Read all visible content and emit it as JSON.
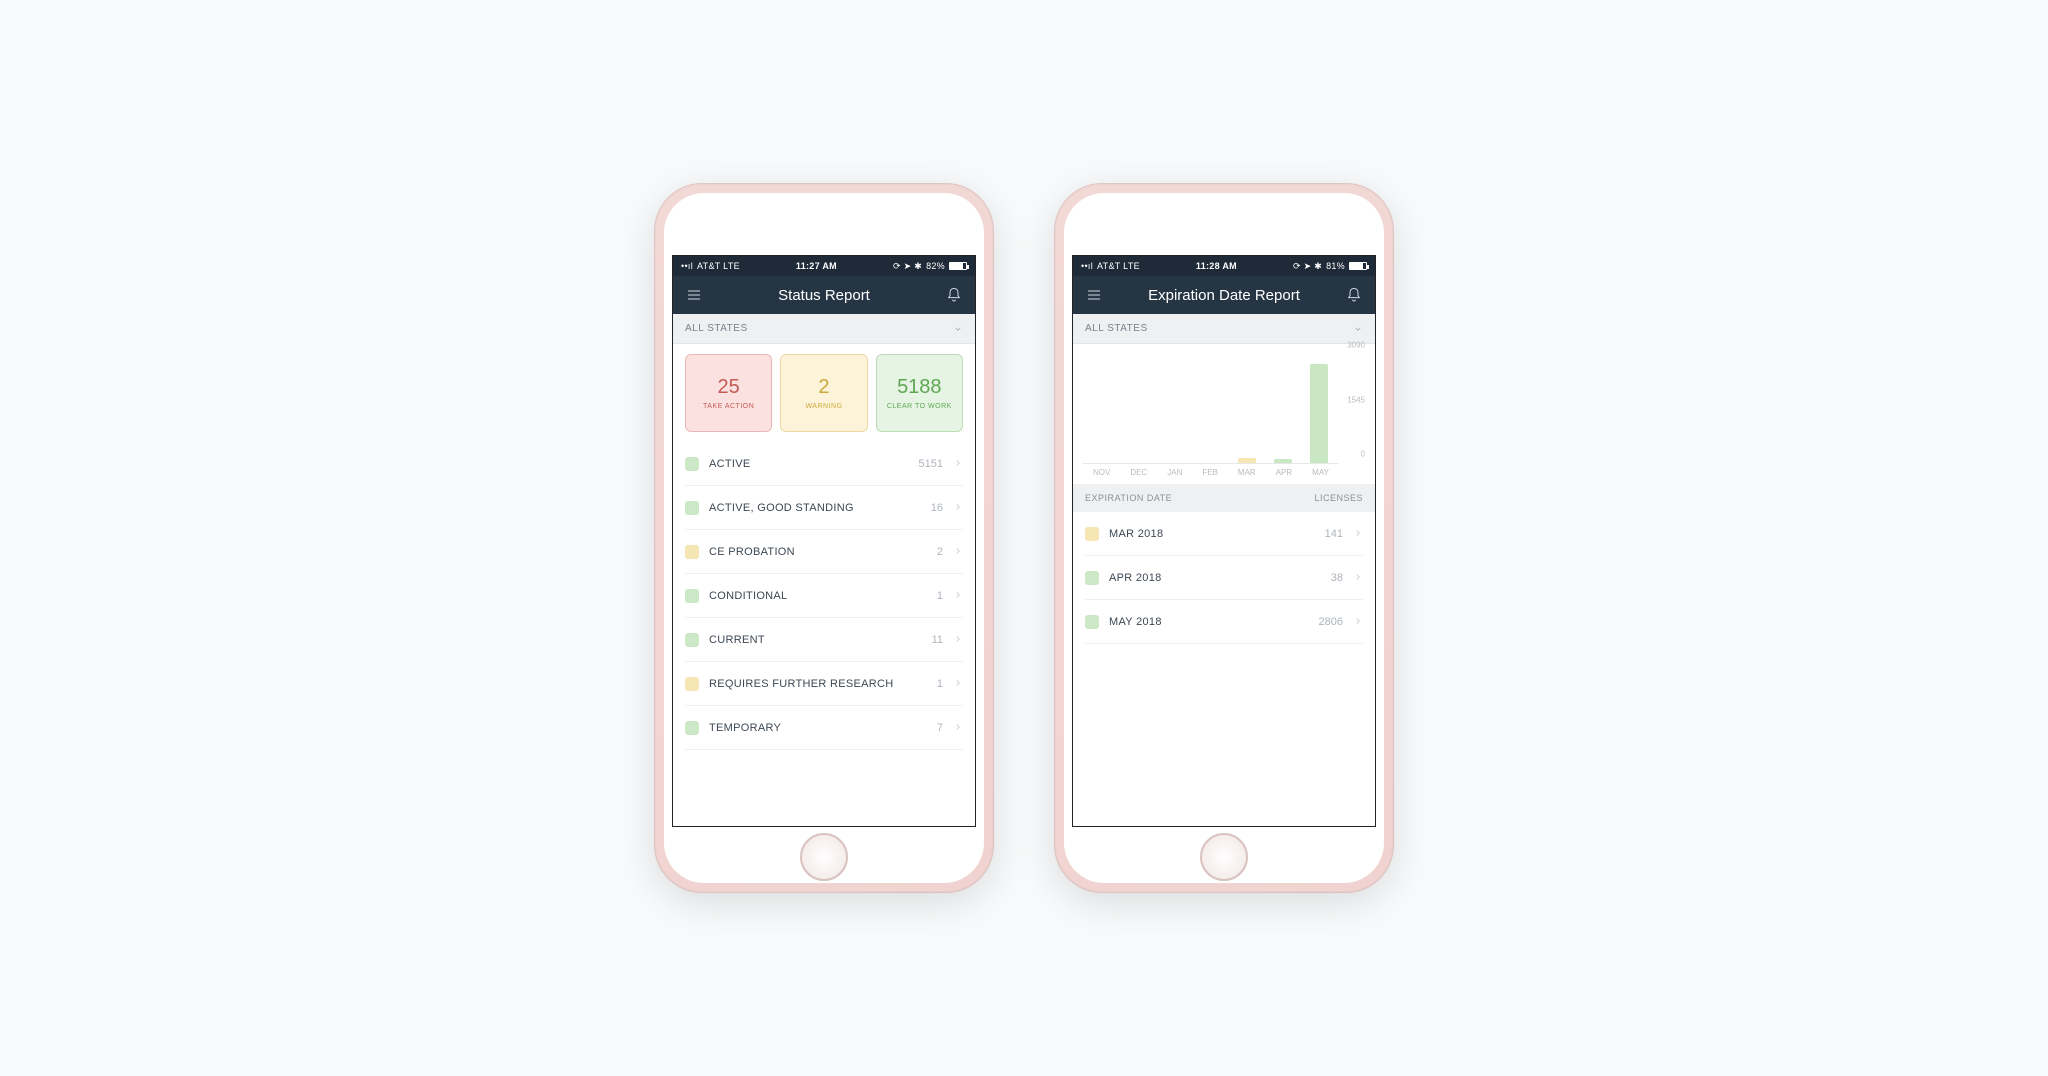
{
  "colors": {
    "green_swatch": "#cde8c6",
    "yellow_swatch": "#f5e6b3",
    "green_bar": "#c9e7c2",
    "yellow_bar": "#f5e6b3"
  },
  "phone_left": {
    "statusbar": {
      "carrier": "AT&T  LTE",
      "time": "11:27 AM",
      "battery_pct": "82%"
    },
    "header": {
      "title": "Status Report"
    },
    "filter": {
      "label": "ALL STATES"
    },
    "cards": [
      {
        "value": "25",
        "label": "TAKE ACTION",
        "variant": "red"
      },
      {
        "value": "2",
        "label": "WARNING",
        "variant": "yellow"
      },
      {
        "value": "5188",
        "label": "CLEAR TO WORK",
        "variant": "green"
      }
    ],
    "list": [
      {
        "swatch": "green",
        "label": "ACTIVE",
        "value": "5151"
      },
      {
        "swatch": "green",
        "label": "ACTIVE, GOOD STANDING",
        "value": "16"
      },
      {
        "swatch": "yellow",
        "label": "CE PROBATION",
        "value": "2"
      },
      {
        "swatch": "green",
        "label": "CONDITIONAL",
        "value": "1"
      },
      {
        "swatch": "green",
        "label": "CURRENT",
        "value": "11"
      },
      {
        "swatch": "yellow",
        "label": "REQUIRES FURTHER RESEARCH",
        "value": "1"
      },
      {
        "swatch": "green",
        "label": "TEMPORARY",
        "value": "7"
      }
    ]
  },
  "phone_right": {
    "statusbar": {
      "carrier": "AT&T  LTE",
      "time": "11:28 AM",
      "battery_pct": "81%"
    },
    "header": {
      "title": "Expiration Date Report"
    },
    "filter": {
      "label": "ALL STATES"
    },
    "table_header": {
      "col1": "EXPIRATION DATE",
      "col2": "LICENSES"
    },
    "list": [
      {
        "swatch": "yellow",
        "label": "MAR 2018",
        "value": "141"
      },
      {
        "swatch": "green",
        "label": "APR 2018",
        "value": "38"
      },
      {
        "swatch": "green",
        "label": "MAY 2018",
        "value": "2806"
      }
    ]
  },
  "chart_data": {
    "type": "bar",
    "categories": [
      "NOV",
      "DEC",
      "JAN",
      "FEB",
      "MAR",
      "APR",
      "MAY"
    ],
    "series": [
      {
        "name": "Licenses",
        "values": [
          0,
          0,
          0,
          0,
          141,
          38,
          2806
        ],
        "colors": [
          "green",
          "green",
          "green",
          "green",
          "yellow",
          "green",
          "green"
        ]
      }
    ],
    "ylim": [
      0,
      3090
    ],
    "yticks": [
      0,
      1545,
      3090
    ],
    "title": "",
    "xlabel": "",
    "ylabel": ""
  }
}
